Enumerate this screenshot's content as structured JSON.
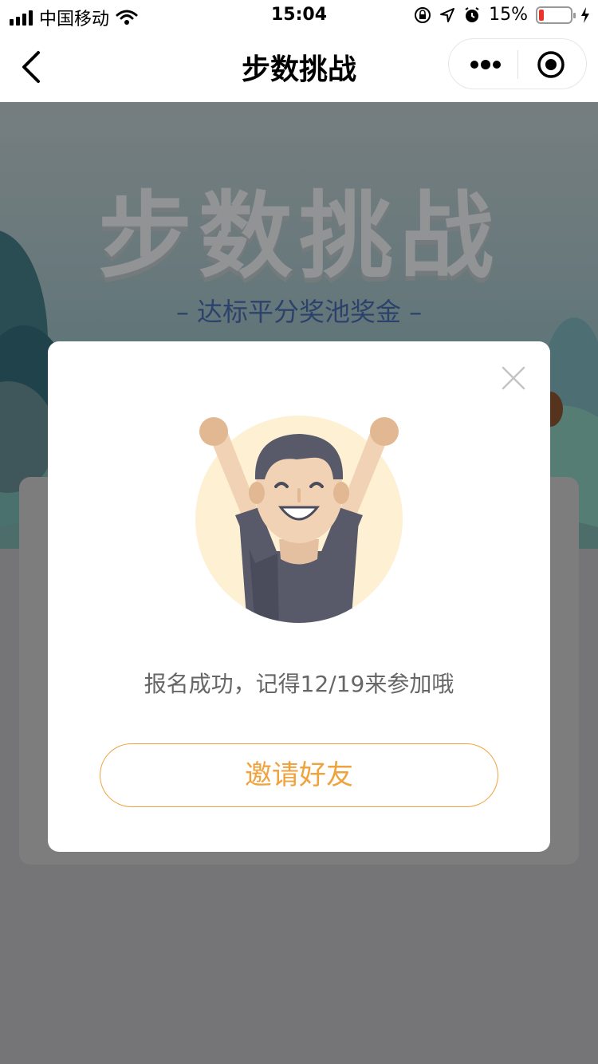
{
  "status_bar": {
    "carrier": "中国移动",
    "time": "15:04",
    "battery_percent": "15%",
    "battery_level": 0.15,
    "icons": [
      "signal-icon",
      "wifi-icon",
      "orientation-lock-icon",
      "location-icon",
      "alarm-icon",
      "battery-icon",
      "charging-icon"
    ]
  },
  "navbar": {
    "title": "步数挑战",
    "icons": [
      "back-icon",
      "more-icon",
      "target-icon"
    ]
  },
  "banner": {
    "title": "步数挑战",
    "subtitle": "– 达标平分奖池奖金 –"
  },
  "modal": {
    "message": "报名成功，记得12/19来参加哦",
    "invite_label": "邀请好友",
    "icons": [
      "close-icon",
      "cheering-person-illustration"
    ]
  },
  "colors": {
    "accent": "#f0a23c",
    "battery_low": "#e8352c",
    "banner_subtitle": "#3f5f9a"
  }
}
